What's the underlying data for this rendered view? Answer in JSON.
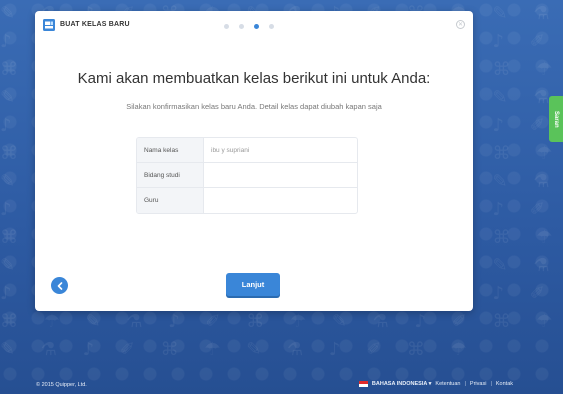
{
  "app": {
    "brand_title": "BUAT KELAS BARU",
    "brand_icon": "classroom-logo-icon",
    "steps": [
      {
        "active": false
      },
      {
        "active": false
      },
      {
        "active": true
      },
      {
        "active": false
      }
    ],
    "close_icon": "close-icon"
  },
  "content": {
    "heading": "Kami akan membuatkan kelas berikut ini untuk Anda:",
    "subtitle": "Silakan konfirmasikan kelas baru Anda. Detail kelas dapat diubah kapan saja",
    "form": {
      "rows": [
        {
          "label": "Nama kelas",
          "value": "ibu y supriani"
        },
        {
          "label": "Bidang studi",
          "value": ""
        },
        {
          "label": "Guru",
          "value": ""
        }
      ]
    }
  },
  "actions": {
    "back_icon": "chevron-left-icon",
    "next_label": "Lanjut"
  },
  "feedback": {
    "label": "Saran"
  },
  "footer": {
    "copyright": "© 2015 Quipper, Ltd.",
    "language": "BAHASA INDONESIA ▾",
    "links": [
      "Ketentuan",
      "Privasi",
      "Kontak"
    ]
  },
  "colors": {
    "background": "#2f5fa8",
    "accent": "#3a86d8",
    "feedback": "#5ac35a"
  }
}
